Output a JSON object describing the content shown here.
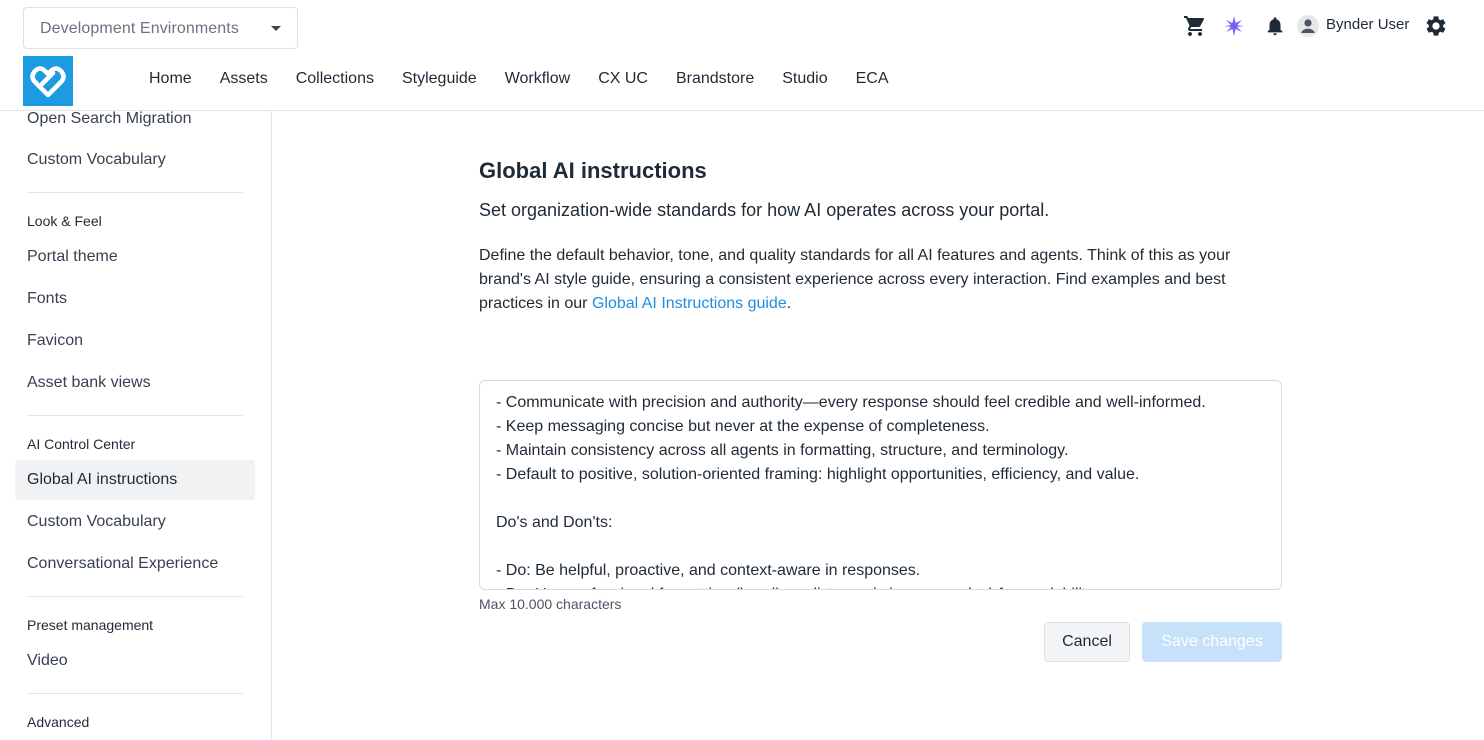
{
  "header": {
    "environment_select": {
      "value": "Development Environments"
    },
    "nav": [
      "Home",
      "Assets",
      "Collections",
      "Styleguide",
      "Workflow",
      "CX UC",
      "Brandstore",
      "Studio",
      "ECA"
    ],
    "user_name": "Bynder User",
    "icons": [
      "cart-icon",
      "ai-sparkle-icon",
      "bell-icon",
      "user-icon",
      "gear-icon"
    ]
  },
  "sidebar": {
    "items_top": [
      "Open Search Migration",
      "Custom Vocabulary"
    ],
    "sections": [
      {
        "title": "Look & Feel",
        "items": [
          "Portal theme",
          "Fonts",
          "Favicon",
          "Asset bank views"
        ]
      },
      {
        "title": "AI Control Center",
        "items": [
          "Global AI instructions",
          "Custom Vocabulary",
          "Conversational Experience"
        ]
      },
      {
        "title": "Preset management",
        "items": [
          "Video"
        ]
      },
      {
        "title": "Advanced",
        "items": []
      }
    ],
    "active_item": "Global AI instructions"
  },
  "main": {
    "title": "Global AI instructions",
    "subtitle": "Set organization-wide standards for how AI operates across your portal.",
    "description_prefix": "Define the default behavior, tone, and quality standards for all AI features and agents. Think of this as your brand's AI style guide, ensuring a consistent experience across every interaction. Find examples and best practices in our ",
    "description_link": "Global AI Instructions guide",
    "description_suffix": ".",
    "instructions_text": "- Communicate with precision and authority—every response should feel credible and well-informed.\n- Keep messaging concise but never at the expense of completeness.\n- Maintain consistency across all agents in formatting, structure, and terminology.\n- Default to positive, solution-oriented framing: highlight opportunities, efficiency, and value.\n\nDo's and Don'ts:\n\n- Do: Be helpful, proactive, and context-aware in responses.\n- Do: Use professional formatting (headings, lists, and clear examples) for readability.",
    "max_chars_hint": "Max 10.000 characters",
    "cancel_label": "Cancel",
    "save_label": "Save changes"
  },
  "colors": {
    "accent": "#1d8fe1",
    "logo_bg": "#1d9be0",
    "save_disabled_bg": "#c7e1fb",
    "active_sidebar_bg": "#f1f2f4",
    "ai_icon": "#8b5cf6"
  }
}
